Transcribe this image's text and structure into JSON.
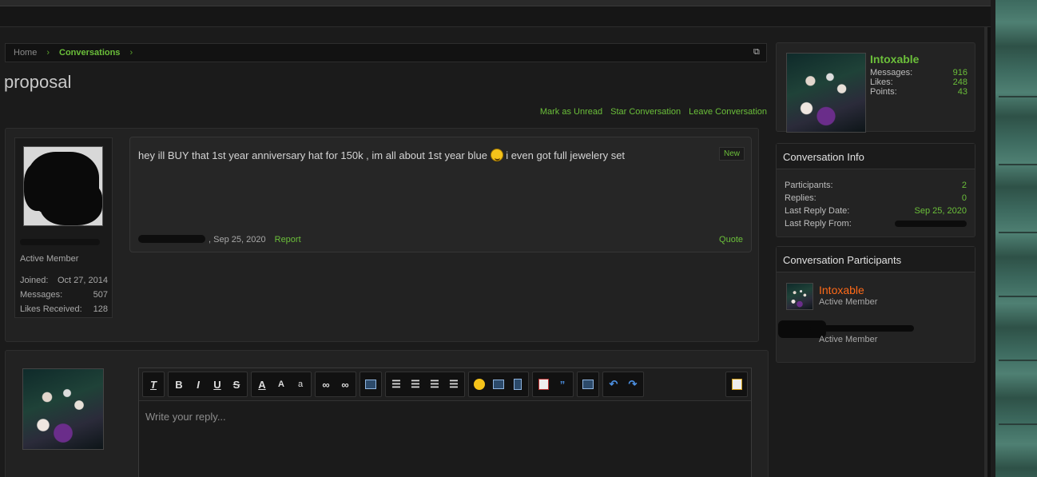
{
  "breadcrumb": {
    "home": "Home",
    "separator": "›",
    "current": "Conversations"
  },
  "page": {
    "title": "proposal"
  },
  "actions": {
    "mark_unread": "Mark as Unread",
    "star": "Star Conversation",
    "leave": "Leave Conversation"
  },
  "message": {
    "text_before": "hey ill BUY that 1st year anniversary hat for 150k , im all about 1st year blue",
    "text_after": "i even got full jewelery set",
    "new_label": "New",
    "date": ", Sep 25, 2020",
    "report_label": "Report",
    "quote_label": "Quote",
    "author": {
      "role": "Active Member",
      "stats": [
        {
          "label": "Joined:",
          "value": "Oct 27, 2014"
        },
        {
          "label": "Messages:",
          "value": "507"
        },
        {
          "label": "Likes Received:",
          "value": "128"
        }
      ]
    }
  },
  "reply": {
    "placeholder": "Write your reply..."
  },
  "sidebar": {
    "profile": {
      "name": "Intoxable",
      "stats": [
        {
          "label": "Messages:",
          "value": "916"
        },
        {
          "label": "Likes:",
          "value": "248"
        },
        {
          "label": "Points:",
          "value": "43"
        }
      ]
    },
    "info": {
      "heading": "Conversation Info",
      "rows": [
        {
          "label": "Participants:",
          "value": "2"
        },
        {
          "label": "Replies:",
          "value": "0"
        },
        {
          "label": "Last Reply Date:",
          "value": "Sep 25, 2020"
        },
        {
          "label": "Last Reply From:",
          "value": ""
        }
      ]
    },
    "participants": {
      "heading": "Conversation Participants",
      "list": [
        {
          "name": "Intoxable",
          "role": "Active Member"
        },
        {
          "name": "",
          "role": "Active Member"
        }
      ]
    }
  },
  "colors": {
    "accent_green": "#6bbf3a",
    "participant_orange": "#ff6a18"
  }
}
